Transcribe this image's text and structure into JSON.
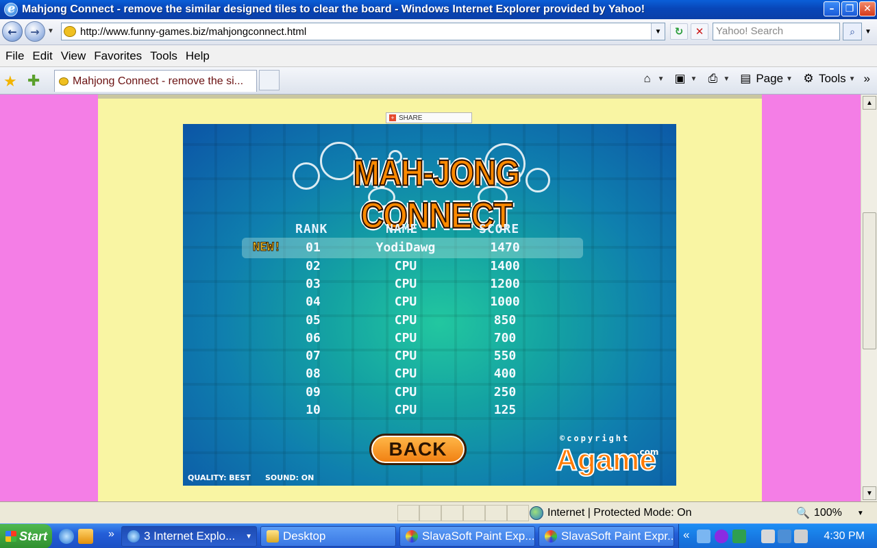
{
  "window": {
    "title": "Mahjong Connect - remove the similar designed tiles to clear the board - Windows Internet Explorer provided by Yahoo!",
    "minimize": "–",
    "restore": "❐",
    "close": "✕"
  },
  "address_bar": {
    "back": "←",
    "forward": "→",
    "url": "http://www.funny-games.biz/mahjongconnect.html",
    "refresh": "↻",
    "stop": "✕",
    "search_placeholder": "Yahoo! Search",
    "search_icon": "⌕"
  },
  "menu": [
    "File",
    "Edit",
    "View",
    "Favorites",
    "Tools",
    "Help"
  ],
  "tabs": {
    "favorites_icon": "★",
    "add_favorites_icon": "✚",
    "active_tab": "Mahjong Connect - remove the si..."
  },
  "command_bar": {
    "home_icon": "⌂",
    "feeds_icon": "▣",
    "print_icon": "⎙",
    "page": "Page",
    "tools": "Tools",
    "more": "»"
  },
  "page": {
    "share_label": "SHARE"
  },
  "game": {
    "logo": "MAH-JONG CONNECT",
    "headers": {
      "rank": "RANK",
      "name": "NAME",
      "score": "SCORE"
    },
    "new_badge": "NEW!",
    "rows": [
      {
        "rank": "01",
        "name": "YodiDawg",
        "score": "1470"
      },
      {
        "rank": "02",
        "name": "CPU",
        "score": "1400"
      },
      {
        "rank": "03",
        "name": "CPU",
        "score": "1200"
      },
      {
        "rank": "04",
        "name": "CPU",
        "score": "1000"
      },
      {
        "rank": "05",
        "name": "CPU",
        "score": "850"
      },
      {
        "rank": "06",
        "name": "CPU",
        "score": "700"
      },
      {
        "rank": "07",
        "name": "CPU",
        "score": "550"
      },
      {
        "rank": "08",
        "name": "CPU",
        "score": "400"
      },
      {
        "rank": "09",
        "name": "CPU",
        "score": "250"
      },
      {
        "rank": "10",
        "name": "CPU",
        "score": "125"
      }
    ],
    "back_button": "BACK",
    "copyright": "©copyright",
    "brand_domain": ".com",
    "brand": "Agame",
    "quality": "QUALITY: BEST",
    "sound": "SOUND: ON"
  },
  "status_bar": {
    "zone": "Internet | Protected Mode: On",
    "zoom": "100%"
  },
  "taskbar": {
    "start": "Start",
    "more": "»",
    "tasks": [
      {
        "label": "3 Internet Explo...",
        "active": true
      },
      {
        "label": "Desktop",
        "active": false
      },
      {
        "label": "SlavaSoft Paint Exp...",
        "active": false
      },
      {
        "label": "SlavaSoft Paint Expr...",
        "active": false
      }
    ],
    "tray_more": "«",
    "clock": "4:30 PM"
  }
}
